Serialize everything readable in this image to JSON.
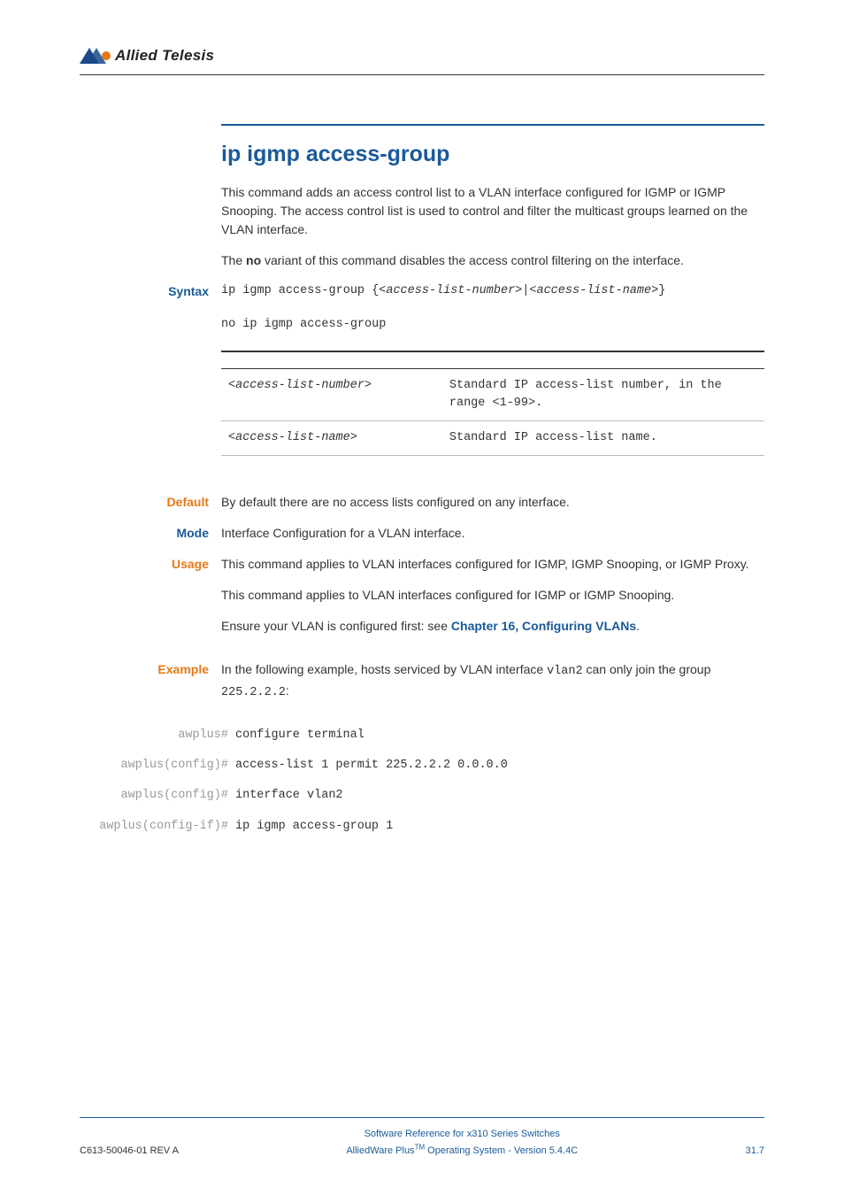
{
  "logo": {
    "brand": "Allied Telesis"
  },
  "cmd": {
    "title": "ip igmp access-group",
    "intro": "This command adds an access control list to a VLAN interface configured for IGMP or IGMP Snooping. The access control list is used to control and filter the multicast groups learned on the VLAN interface.",
    "no_variant_pre": "The ",
    "no_variant_bold": "no",
    "no_variant_post": " variant of this command disables the access control filtering on the interface."
  },
  "labels": {
    "syntax": "Syntax",
    "default": "Default",
    "mode": "Mode",
    "usage": "Usage",
    "example": "Example"
  },
  "syntax": {
    "line1_a": "ip igmp access-group {<",
    "line1_b": "access-list-number",
    "line1_c": ">|<",
    "line1_d": "access-list-name",
    "line1_e": ">}",
    "line2": "no ip igmp access-group"
  },
  "params": [
    {
      "name": "<access-list-number>",
      "desc": "Standard IP access-list number, in the range <1-99>."
    },
    {
      "name": "<access-list-name>",
      "desc": "Standard IP access-list name."
    }
  ],
  "default_text": "By default there are no access lists configured on any interface.",
  "mode_text": "Interface Configuration for a VLAN interface.",
  "usage": {
    "p1": "This command applies to VLAN interfaces configured for IGMP, IGMP Snooping, or IGMP Proxy.",
    "p2": "This command applies to VLAN interfaces configured for IGMP or IGMP Snooping.",
    "p3_pre": "Ensure your VLAN is configured first: see ",
    "p3_link": "Chapter 16, Configuring VLANs",
    "p3_post": "."
  },
  "example": {
    "intro_a": "In the following example, hosts serviced by VLAN interface ",
    "intro_code1": "vlan2",
    "intro_b": " can only join the group ",
    "intro_code2": "225.2.2.2",
    "intro_c": ":",
    "rows": [
      {
        "prompt": "awplus#",
        "cmd": "configure terminal"
      },
      {
        "prompt": "awplus(config)#",
        "cmd": "access-list 1 permit 225.2.2.2 0.0.0.0"
      },
      {
        "prompt": "awplus(config)#",
        "cmd": "interface vlan2"
      },
      {
        "prompt": "awplus(config-if)#",
        "cmd": "ip igmp access-group 1"
      }
    ]
  },
  "footer": {
    "left": "C613-50046-01 REV A",
    "center1": "Software Reference for x310 Series Switches",
    "center2_a": "AlliedWare Plus",
    "center2_sup": "TM",
    "center2_b": " Operating System - Version 5.4.4C",
    "right": "31.7"
  }
}
